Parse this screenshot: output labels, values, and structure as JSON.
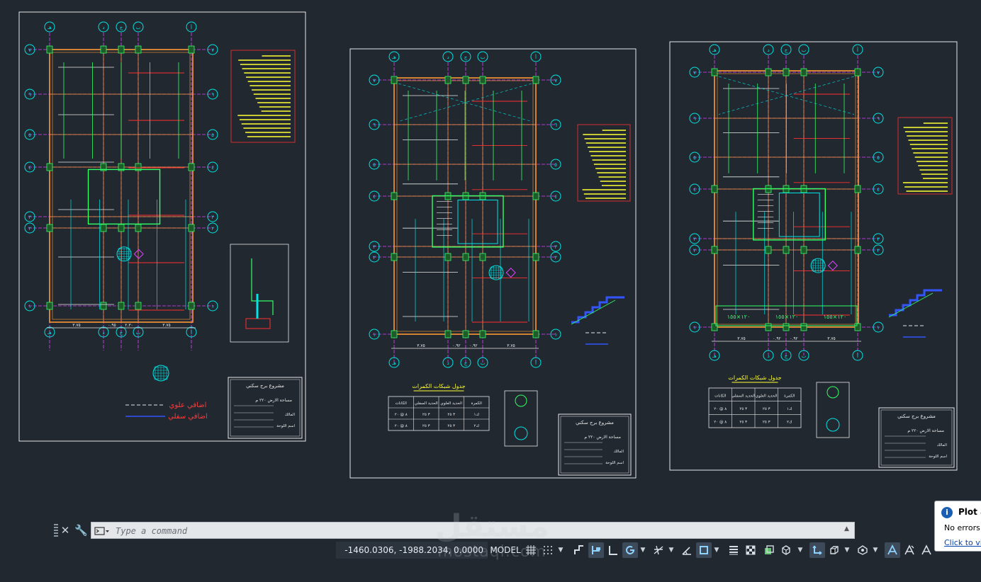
{
  "command_line": {
    "placeholder": "Type a command",
    "close_glyph": "✕",
    "customize_glyph": "🔧",
    "scroll_glyph": "▲"
  },
  "status_bar": {
    "coordinates": "-1460.0306, -1988.2034, 0.0000",
    "space": "MODEL"
  },
  "watermark": {
    "arabic": "مستقل",
    "latin": "mostaql.com"
  },
  "notification": {
    "title": "Plot a",
    "message": "No errors",
    "link": "Click to vi"
  },
  "sheets": [
    {
      "grid_top": [
        "هـ",
        "د",
        "ج",
        "ب",
        "أ"
      ],
      "grid_side": [
        "٧",
        "٦",
        "٥",
        "٤",
        "٣",
        "٢",
        "١"
      ],
      "legend": [
        {
          "label": "اضافي علوي",
          "color": "#ff3b3b"
        },
        {
          "label": "اضافي سفلي",
          "color": "#ff3b3b"
        }
      ],
      "dims": [
        "٣.٧٥",
        "٠.٩٥",
        "٢.٣٠",
        "٣.٧٥"
      ],
      "title_block": [
        "مشروع برج سكني",
        "مساحة الارض ٢٢٠ م",
        "المالك",
        "اسم اللوحة"
      ]
    },
    {
      "grid_top": [
        "هـ",
        "د",
        "ج",
        "ب",
        "أ"
      ],
      "grid_side": [
        "٧",
        "٦",
        "٥",
        "٤",
        "٣",
        "٢",
        "١"
      ],
      "table_title": "جدول شبكات الكمرات",
      "table_headers": [
        "الكمرة",
        "الحديد العلوي",
        "الحديد السفلي",
        "الكانات"
      ],
      "table_rows": [
        [
          "ك١",
          "٣ ٢٥",
          "٣ ٢٥",
          "٨ @ ٢٠"
        ],
        [
          "ك٢",
          "٣ ٢٥",
          "٣ ٢٥",
          "٨ @ ٢٠"
        ]
      ],
      "dims": [
        "٣.٧٥",
        "٠.٩٢",
        "٠.٩٢",
        "٣.٧٥"
      ],
      "title_block": [
        "مشروع برج سكني",
        "مساحة الارض ٢٢٠ م",
        "المالك",
        "اسم اللوحة"
      ]
    },
    {
      "grid_top": [
        "هـ",
        "د",
        "ج",
        "ب",
        "أ"
      ],
      "grid_side": [
        "٧",
        "٦",
        "٥",
        "٤",
        "٣",
        "٢",
        "١"
      ],
      "table_title": "جدول شبكات الكمرات",
      "beams": [
        "١٢٠×١٥٥",
        "١٢٠×١٥٥",
        "١٢٠×١٥٥"
      ],
      "table_headers": [
        "الكمرة",
        "الحديد العلوي",
        "الحديد السفلي",
        "الكانات"
      ],
      "table_rows": [
        [
          "ك١",
          "٣ ٢٥",
          "٣ ٢٥",
          "٨ @ ٢٠"
        ],
        [
          "ك٢",
          "٣ ٢٥",
          "٣ ٢٥",
          "٨ @ ٢٠"
        ]
      ],
      "dims": [
        "٣.٧٥",
        "٠.٩٢",
        "٠.٩٢",
        "٣.٧٥"
      ],
      "title_block": [
        "مشروع برج سكني",
        "مساحة الارض ٢٢٠ م",
        "المالك",
        "اسم اللوحة"
      ]
    }
  ]
}
